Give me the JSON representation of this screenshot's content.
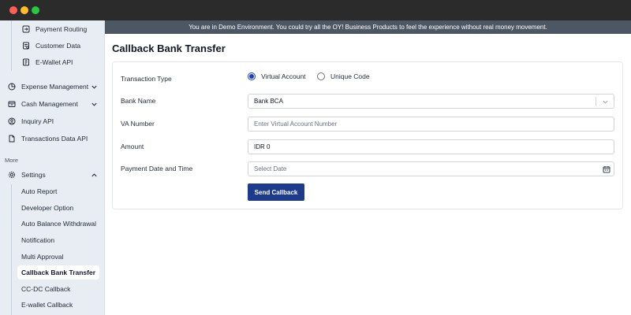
{
  "window": {
    "traffic_lights": [
      "close",
      "minimize",
      "maximize"
    ]
  },
  "sidebar": {
    "top_items": [
      {
        "label": "Payment Routing",
        "icon": "routing-icon"
      },
      {
        "label": "Customer Data",
        "icon": "customer-data-icon"
      },
      {
        "label": "E-Wallet API",
        "icon": "wallet-icon"
      }
    ],
    "main_items": [
      {
        "label": "Expense Management",
        "icon": "expense-icon",
        "expanded": false
      },
      {
        "label": "Cash Management",
        "icon": "cash-icon",
        "expanded": false
      },
      {
        "label": "Inquiry API",
        "icon": "inquiry-icon"
      },
      {
        "label": "Transactions Data API",
        "icon": "document-icon"
      }
    ],
    "section_label": "More",
    "settings": {
      "label": "Settings",
      "icon": "gear-icon",
      "expanded": true
    },
    "settings_items": [
      {
        "label": "Auto Report"
      },
      {
        "label": "Developer Option"
      },
      {
        "label": "Auto Balance Withdrawal"
      },
      {
        "label": "Notification"
      },
      {
        "label": "Multi Approval"
      },
      {
        "label": "Callback Bank Transfer",
        "active": true
      },
      {
        "label": "CC-DC Callback"
      },
      {
        "label": "E-wallet Callback"
      }
    ]
  },
  "banner": {
    "text": "You are in Demo Environment. You could try all the OY! Business Products to feel the experience without real money movement."
  },
  "page": {
    "title": "Callback Bank Transfer"
  },
  "form": {
    "transaction_type": {
      "label": "Transaction Type",
      "options": [
        {
          "label": "Virtual Account",
          "selected": true
        },
        {
          "label": "Unique Code",
          "selected": false
        }
      ]
    },
    "bank_name": {
      "label": "Bank Name",
      "value": "Bank BCA"
    },
    "va_number": {
      "label": "VA Number",
      "placeholder": "Enter Virtual Account Number",
      "value": ""
    },
    "amount": {
      "label": "Amount",
      "value": "IDR 0"
    },
    "payment_date": {
      "label": "Payment Date and Time",
      "placeholder": "Select Date"
    },
    "submit_label": "Send Callback"
  },
  "colors": {
    "accent": "#1e3a8a",
    "banner": "#4d5763",
    "sidebar_bg": "#e8edf3"
  }
}
